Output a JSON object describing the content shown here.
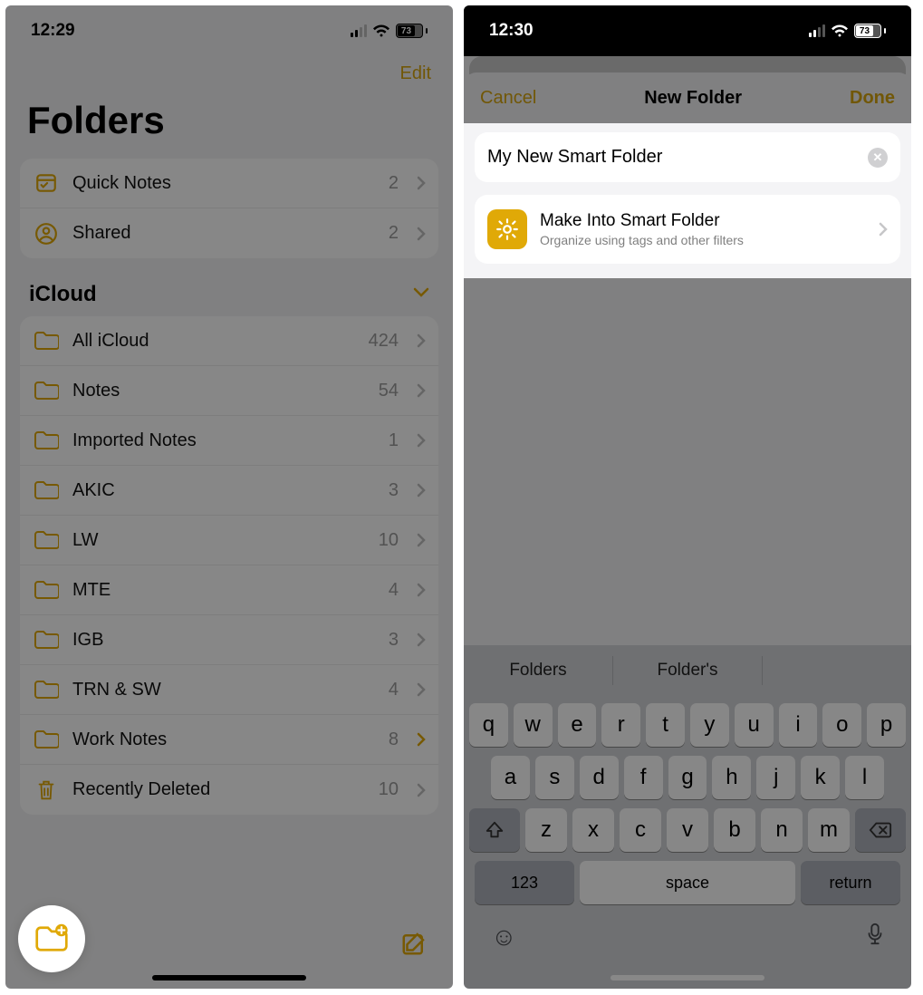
{
  "left": {
    "status": {
      "time": "12:29",
      "battery": "73"
    },
    "edit": "Edit",
    "title": "Folders",
    "top_rows": [
      {
        "icon": "quick-notes",
        "label": "Quick Notes",
        "count": "2"
      },
      {
        "icon": "shared",
        "label": "Shared",
        "count": "2"
      }
    ],
    "section": "iCloud",
    "icloud_rows": [
      {
        "label": "All iCloud",
        "count": "424"
      },
      {
        "label": "Notes",
        "count": "54"
      },
      {
        "label": "Imported Notes",
        "count": "1"
      },
      {
        "label": "AKIC",
        "count": "3"
      },
      {
        "label": "LW",
        "count": "10"
      },
      {
        "label": "MTE",
        "count": "4"
      },
      {
        "label": "IGB",
        "count": "3"
      },
      {
        "label": "TRN & SW",
        "count": "4"
      },
      {
        "label": "Work Notes",
        "count": "8",
        "hl": true
      },
      {
        "label": "Recently Deleted",
        "count": "10",
        "icon": "trash"
      }
    ]
  },
  "right": {
    "status": {
      "time": "12:30",
      "battery": "73"
    },
    "cancel": "Cancel",
    "title": "New Folder",
    "done": "Done",
    "input": "My New Smart Folder",
    "smart": {
      "title": "Make Into Smart Folder",
      "sub": "Organize using tags and other filters"
    },
    "suggestions": [
      "Folders",
      "Folder's"
    ],
    "kb": {
      "r1": [
        "q",
        "w",
        "e",
        "r",
        "t",
        "y",
        "u",
        "i",
        "o",
        "p"
      ],
      "r2": [
        "a",
        "s",
        "d",
        "f",
        "g",
        "h",
        "j",
        "k",
        "l"
      ],
      "r3": [
        "z",
        "x",
        "c",
        "v",
        "b",
        "n",
        "m"
      ],
      "n123": "123",
      "space": "space",
      "ret": "return"
    }
  }
}
